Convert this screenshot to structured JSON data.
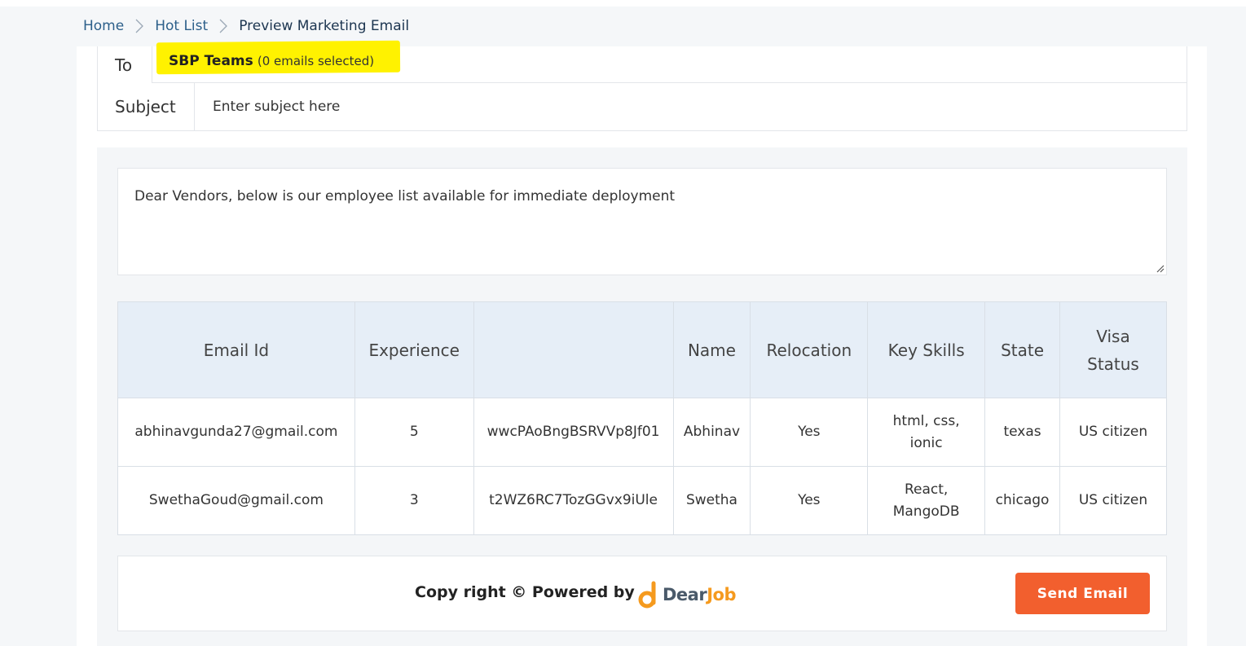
{
  "breadcrumb": {
    "items": [
      "Home",
      "Hot List"
    ],
    "current": "Preview Marketing Email"
  },
  "form": {
    "to_label": "To",
    "to_team": "SBP Teams",
    "to_count": "(0 emails selected)",
    "subject_label": "Subject",
    "subject_placeholder": "Enter subject here"
  },
  "message": "Dear Vendors, below is our employee list available for immediate deployment",
  "table": {
    "headers": [
      "Email Id",
      "Experience",
      "",
      "Name",
      "Relocation",
      "Key Skills",
      "State",
      "Visa Status"
    ],
    "rows": [
      [
        "abhinavgunda27@gmail.com",
        "5",
        "wwcPAoBngBSRVVp8Jf01",
        "Abhinav",
        "Yes",
        "html, css, ionic",
        "texas",
        "US citizen"
      ],
      [
        "SwethaGoud@gmail.com",
        "3",
        "t2WZ6RC7TozGGvx9iUle",
        "Swetha",
        "Yes",
        "React, MangoDB",
        "chicago",
        "US citizen"
      ]
    ]
  },
  "footer": {
    "copyright": "Copy right © Powered by",
    "logo_text_1": "Dear",
    "logo_text_2": "Job",
    "send_label": "Send Email"
  },
  "colors": {
    "accent": "#f25f2e",
    "highlight": "#fff200",
    "header_bg": "#e6eef7",
    "logo_orange": "#f59a1e"
  },
  "icons": [
    "chevron-right-icon",
    "resize-grip-icon",
    "dearjob-logo-icon"
  ]
}
